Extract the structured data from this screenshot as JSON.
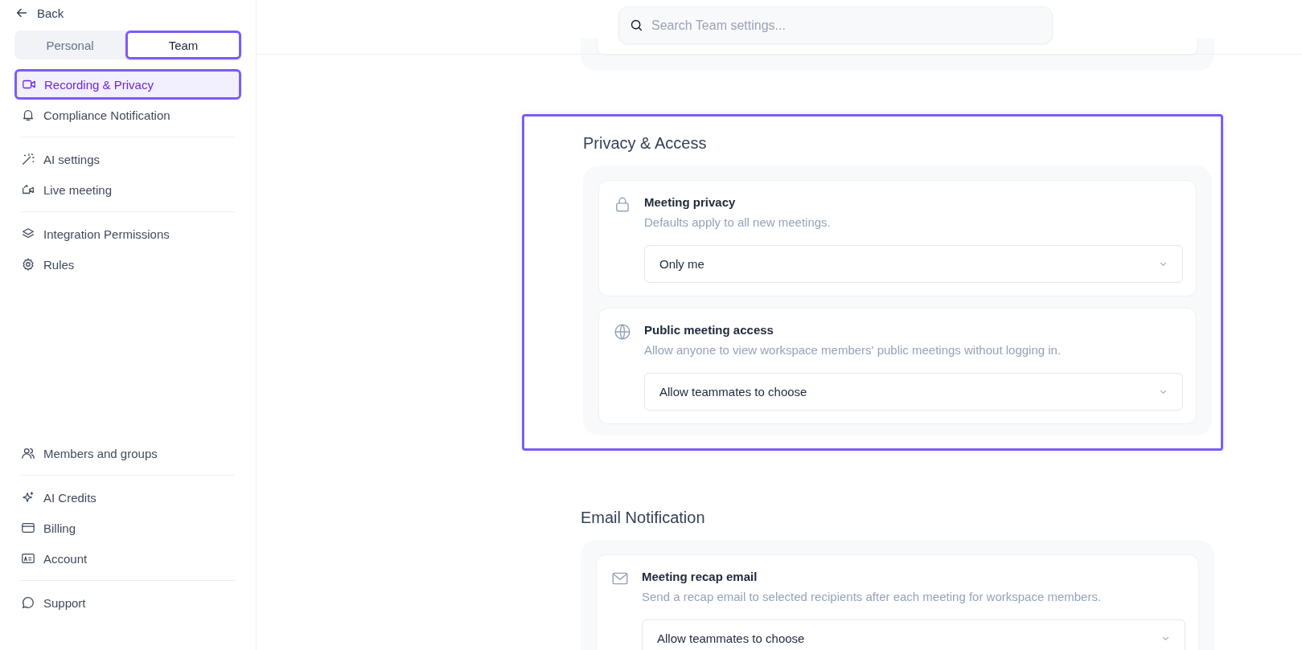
{
  "back": "Back",
  "tabs": [
    {
      "label": "Personal",
      "selected": false
    },
    {
      "label": "Team",
      "selected": true
    }
  ],
  "nav_groups": [
    [
      {
        "label": "Recording & Privacy",
        "selected": true
      },
      {
        "label": "Compliance Notification",
        "selected": false
      }
    ],
    [
      {
        "label": "AI settings",
        "selected": false
      },
      {
        "label": "Live meeting",
        "selected": false
      }
    ],
    [
      {
        "label": "Integration Permissions",
        "selected": false
      },
      {
        "label": "Rules",
        "selected": false
      }
    ]
  ],
  "nav_bottom_groups": [
    [
      {
        "label": "Members and groups",
        "selected": false
      }
    ],
    [
      {
        "label": "AI Credits",
        "selected": false
      },
      {
        "label": "Billing",
        "selected": false
      },
      {
        "label": "Account",
        "selected": false
      }
    ],
    [
      {
        "label": "Support",
        "selected": false
      }
    ]
  ],
  "search": {
    "placeholder": "Search Team settings..."
  },
  "sections": [
    {
      "title": "Privacy & Access",
      "highlighted": true,
      "settings": [
        {
          "title": "Meeting privacy",
          "description": "Defaults apply to all new meetings.",
          "value": "Only me"
        },
        {
          "title": "Public meeting access",
          "description": "Allow anyone to view workspace members' public meetings without logging in.",
          "value": "Allow teammates to choose"
        }
      ]
    },
    {
      "title": "Email Notification",
      "highlighted": false,
      "settings": [
        {
          "title": "Meeting recap email",
          "description": "Send a recap email to selected recipients after each meeting for workspace members.",
          "value": "Allow teammates to choose"
        }
      ]
    }
  ]
}
